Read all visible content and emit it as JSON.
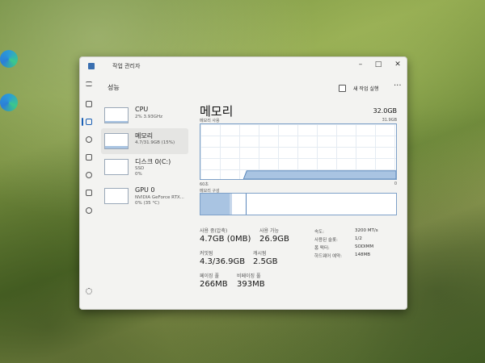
{
  "window": {
    "title": "작업 관리자"
  },
  "header": {
    "section_title": "성능",
    "new_task_label": "새 작업 실행"
  },
  "sidebar": {
    "items": [
      {
        "name": "CPU",
        "sub1": "2% 3.93GHz",
        "sub2": "",
        "fill": 0.05
      },
      {
        "name": "메모리",
        "sub1": "4.7/31.9GB (15%)",
        "sub2": "",
        "fill": 0.15
      },
      {
        "name": "디스크 0(C:)",
        "sub1": "SSD",
        "sub2": "0%",
        "fill": 0.0
      },
      {
        "name": "GPU 0",
        "sub1": "NVIDIA GeForce RTX...",
        "sub2": "0% (35 °C)",
        "fill": 0.0
      }
    ]
  },
  "memory": {
    "title": "메모리",
    "total": "32.0GB",
    "usage_label": "메모리 사용",
    "usage_max": "31.9GB",
    "time_label": "60초",
    "time_end": "0",
    "composition_label": "메모리 구성",
    "usage_fraction": 0.15,
    "composition": {
      "in_use": 0.15,
      "modified": 0.01,
      "standby": 0.07
    }
  },
  "stats": {
    "in_use_label": "사용 중(압축)",
    "in_use_value": "4.7GB (0MB)",
    "available_label": "사용 가능",
    "available_value": "26.9GB",
    "committed_label": "커밋됨",
    "committed_value": "4.3/36.9GB",
    "cached_label": "캐시됨",
    "cached_value": "2.5GB",
    "paged_label": "페이징 풀",
    "paged_value": "266MB",
    "nonpaged_label": "비페이징 풀",
    "nonpaged_value": "393MB"
  },
  "details": [
    {
      "key": "속도:",
      "value": "3200 MT/s"
    },
    {
      "key": "사용된 슬롯:",
      "value": "1/2"
    },
    {
      "key": "폼 팩터:",
      "value": "SODIMM"
    },
    {
      "key": "하드웨어 예약:",
      "value": "148MB"
    }
  ],
  "colors": {
    "accent": "#1a5fb4",
    "graph_line": "#7da0c8",
    "graph_fill": "#a9c4e2"
  }
}
